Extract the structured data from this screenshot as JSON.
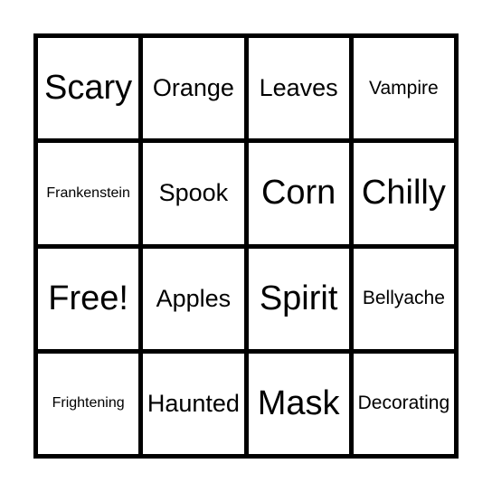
{
  "board": {
    "cells": [
      {
        "text": "Scary",
        "size": "xl"
      },
      {
        "text": "Orange",
        "size": "l"
      },
      {
        "text": "Leaves",
        "size": "l"
      },
      {
        "text": "Vampire",
        "size": "m"
      },
      {
        "text": "Frankenstein",
        "size": "s"
      },
      {
        "text": "Spook",
        "size": "l"
      },
      {
        "text": "Corn",
        "size": "xl"
      },
      {
        "text": "Chilly",
        "size": "xl"
      },
      {
        "text": "Free!",
        "size": "xl"
      },
      {
        "text": "Apples",
        "size": "l"
      },
      {
        "text": "Spirit",
        "size": "xl"
      },
      {
        "text": "Bellyache",
        "size": "m"
      },
      {
        "text": "Frightening",
        "size": "s"
      },
      {
        "text": "Haunted",
        "size": "l"
      },
      {
        "text": "Mask",
        "size": "xl"
      },
      {
        "text": "Decorating",
        "size": "m"
      }
    ]
  }
}
